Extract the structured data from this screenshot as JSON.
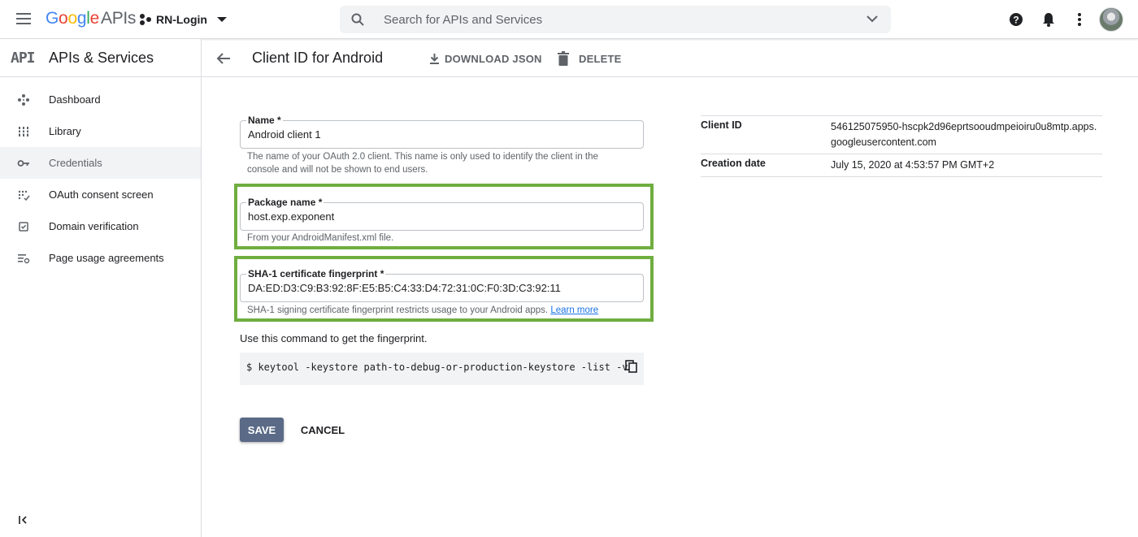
{
  "topbar": {
    "logo_letters": [
      "G",
      "o",
      "o",
      "g",
      "l",
      "e"
    ],
    "logo_apis": "APIs",
    "project_name": "RN-Login",
    "search_placeholder": "Search for APIs and Services",
    "icons": [
      "menu-icon",
      "project-icon",
      "search-icon",
      "chevron-down-icon",
      "help-icon",
      "notifications-icon",
      "more-vert-icon",
      "avatar"
    ]
  },
  "sidebar": {
    "title": "APIs & Services",
    "api_mark": "API",
    "items": [
      {
        "label": "Dashboard",
        "icon": "dashboard-icon"
      },
      {
        "label": "Library",
        "icon": "library-icon"
      },
      {
        "label": "Credentials",
        "icon": "key-icon",
        "active": true
      },
      {
        "label": "OAuth consent screen",
        "icon": "consent-icon"
      },
      {
        "label": "Domain verification",
        "icon": "domain-check-icon"
      },
      {
        "label": "Page usage agreements",
        "icon": "settings-list-icon"
      }
    ]
  },
  "header": {
    "title": "Client ID for Android",
    "download_label": "DOWNLOAD JSON",
    "delete_label": "DELETE"
  },
  "form": {
    "name": {
      "label": "Name *",
      "value": "Android client 1",
      "hint": "The name of your OAuth 2.0 client. This name is only used to identify the client in the console and will not be shown to end users."
    },
    "package": {
      "label": "Package name *",
      "value": "host.exp.exponent",
      "hint": "From your AndroidManifest.xml file."
    },
    "sha1": {
      "label": "SHA-1 certificate fingerprint *",
      "value": "DA:ED:D3:C9:B3:92:8F:E5:B5:C4:33:D4:72:31:0C:F0:3D:C3:92:11",
      "hint": "SHA-1 signing certificate fingerprint restricts usage to your Android apps.",
      "learn_more": "Learn more"
    },
    "command_intro": "Use this command to get the fingerprint.",
    "command": "$ keytool -keystore path-to-debug-or-production-keystore -list -v",
    "save_label": "SAVE",
    "cancel_label": "CANCEL"
  },
  "info": {
    "client_id_label": "Client ID",
    "client_id_value": "546125075950-hscpk2d96eprtsooudmpeioiru0u8mtp.apps.googleusercontent.com",
    "creation_label": "Creation date",
    "creation_value": "July 15, 2020 at 4:53:57 PM GMT+2"
  },
  "colors": {
    "highlight_box": "#6fae3f",
    "save_button": "#5a6a87",
    "link": "#1a73e8"
  }
}
